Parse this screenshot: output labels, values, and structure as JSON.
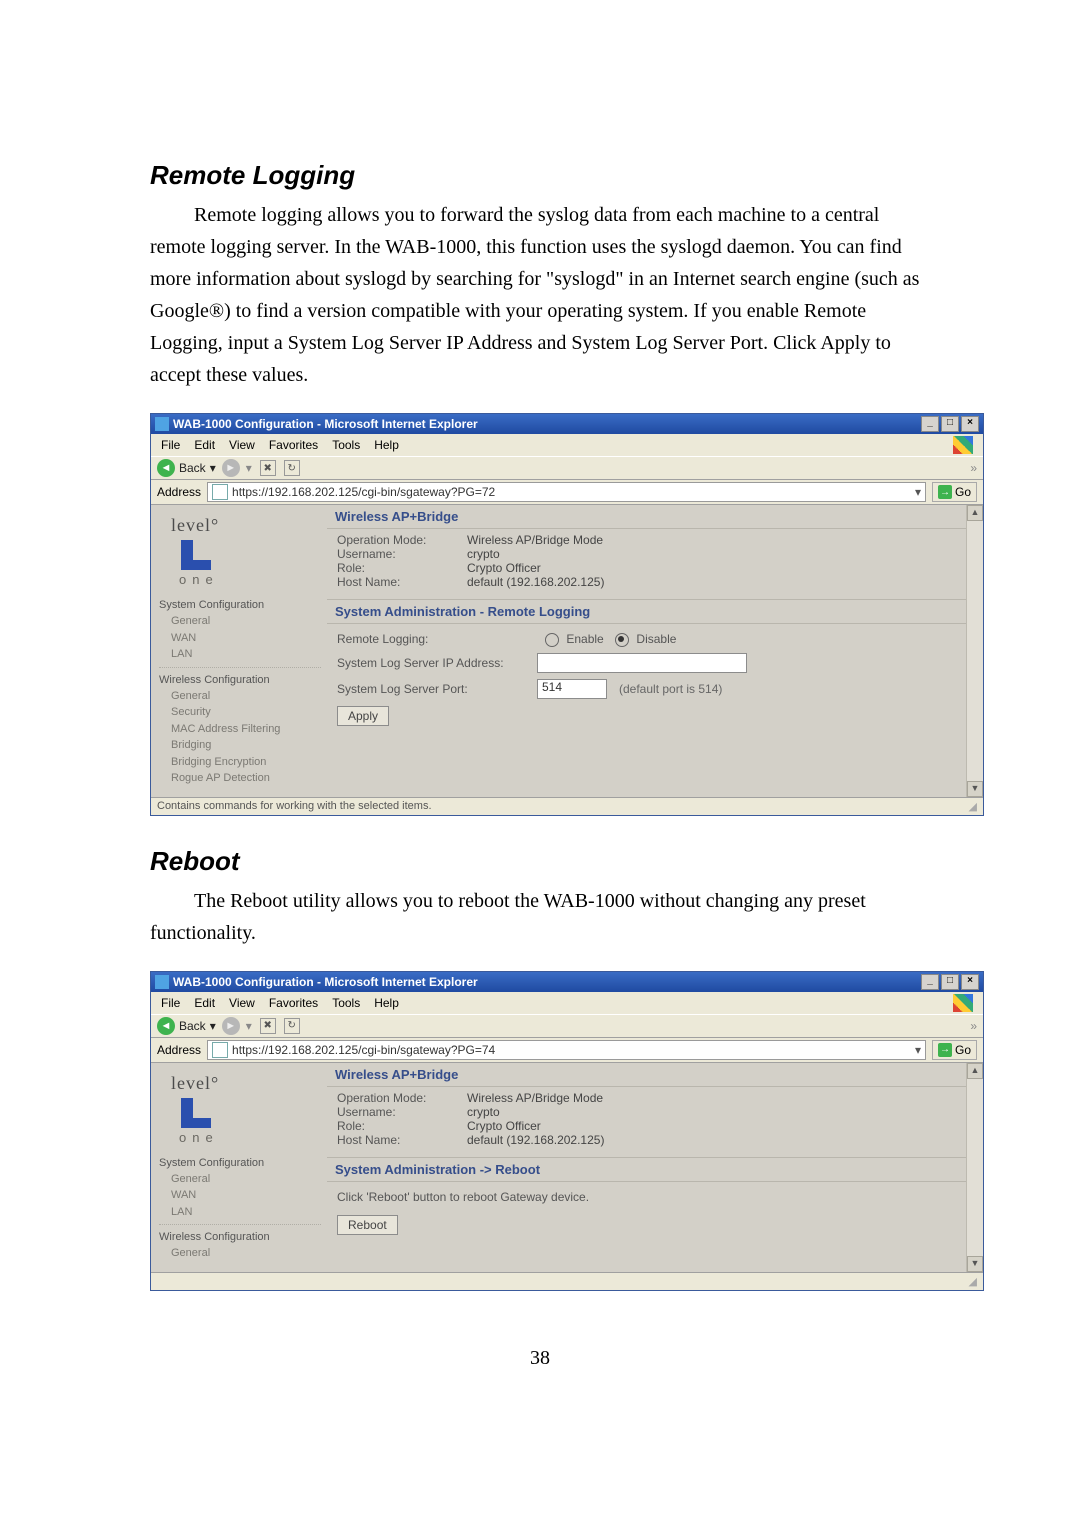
{
  "doc": {
    "section1_title": "Remote Logging",
    "section1_body": "Remote logging allows you to forward the syslog data from each machine to a central remote logging server. In the WAB-1000, this function uses the syslogd daemon. You can find more information about syslogd by searching for \"syslogd\" in an Internet search engine (such as Google®) to find a version compatible with your operating system. If you enable Remote Logging, input a System Log Server IP Address and System Log Server Port. Click Apply to accept these values.",
    "section2_title": "Reboot",
    "section2_body": "The Reboot utility allows you to reboot the WAB-1000 without changing any preset functionality.",
    "page_number": "38"
  },
  "browser1": {
    "window_title": "WAB-1000 Configuration - Microsoft Internet Explorer",
    "menus": [
      "File",
      "Edit",
      "View",
      "Favorites",
      "Tools",
      "Help"
    ],
    "nav_back": "Back",
    "address_label": "Address",
    "address_value": "https://192.168.202.125/cgi-bin/sgateway?PG=72",
    "go_label": "Go",
    "logo_top": "level",
    "logo_bottom": "one",
    "sidebar": {
      "group1": "System Configuration",
      "group1_items": [
        "General",
        "WAN",
        "LAN"
      ],
      "group2": "Wireless Configuration",
      "group2_items": [
        "General",
        "Security",
        "MAC Address Filtering",
        "Bridging",
        "Bridging Encryption",
        "Rogue AP Detection"
      ]
    },
    "main_header": "Wireless AP+Bridge",
    "info": {
      "op_mode_label": "Operation Mode:",
      "op_mode_val": "Wireless AP/Bridge Mode",
      "user_label": "Username:",
      "user_val": "crypto",
      "role_label": "Role:",
      "role_val": "Crypto Officer",
      "host_label": "Host Name:",
      "host_val": "default (192.168.202.125)"
    },
    "subheader": "System Administration - Remote Logging",
    "form": {
      "remote_logging_label": "Remote Logging:",
      "enable": "Enable",
      "disable": "Disable",
      "ip_label": "System Log Server IP Address:",
      "port_label": "System Log Server Port:",
      "port_value": "514",
      "port_hint": "(default port is 514)",
      "apply": "Apply"
    },
    "status": "Contains commands for working with the selected items."
  },
  "browser2": {
    "window_title": "WAB-1000 Configuration - Microsoft Internet Explorer",
    "menus": [
      "File",
      "Edit",
      "View",
      "Favorites",
      "Tools",
      "Help"
    ],
    "nav_back": "Back",
    "address_label": "Address",
    "address_value": "https://192.168.202.125/cgi-bin/sgateway?PG=74",
    "go_label": "Go",
    "logo_top": "level",
    "logo_bottom": "one",
    "sidebar": {
      "group1": "System Configuration",
      "group1_items": [
        "General",
        "WAN",
        "LAN"
      ],
      "group2": "Wireless Configuration",
      "group2_items": [
        "General"
      ]
    },
    "main_header": "Wireless AP+Bridge",
    "info": {
      "op_mode_label": "Operation Mode:",
      "op_mode_val": "Wireless AP/Bridge Mode",
      "user_label": "Username:",
      "user_val": "crypto",
      "role_label": "Role:",
      "role_val": "Crypto Officer",
      "host_label": "Host Name:",
      "host_val": "default (192.168.202.125)"
    },
    "subheader": "System Administration -> Reboot",
    "reboot_text": "Click 'Reboot' button to reboot Gateway device.",
    "reboot_btn": "Reboot"
  }
}
